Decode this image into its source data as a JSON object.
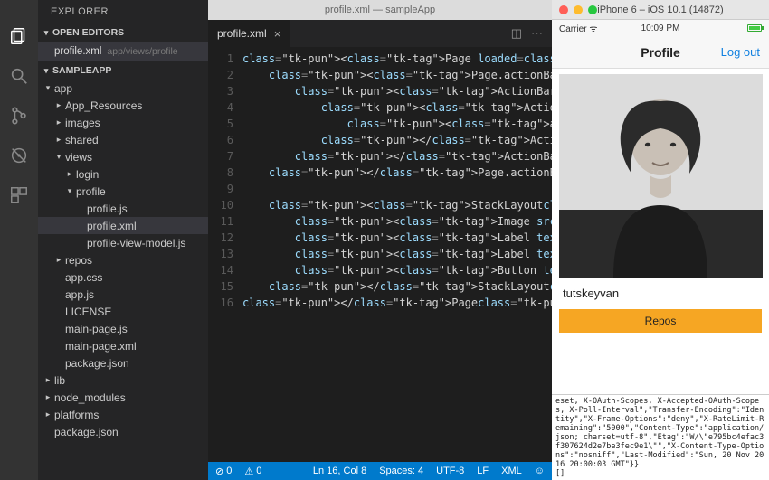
{
  "titlebar": "profile.xml — sampleApp",
  "explorer": {
    "title": "EXPLORER",
    "sections": {
      "open_editors": "OPEN EDITORS",
      "project": "SAMPLEAPP"
    },
    "open_editor": {
      "file": "profile.xml",
      "path": "app/views/profile"
    },
    "tree": [
      {
        "d": 0,
        "tw": "▾",
        "label": "app"
      },
      {
        "d": 1,
        "tw": "▸",
        "label": "App_Resources"
      },
      {
        "d": 1,
        "tw": "▸",
        "label": "images"
      },
      {
        "d": 1,
        "tw": "▸",
        "label": "shared"
      },
      {
        "d": 1,
        "tw": "▾",
        "label": "views"
      },
      {
        "d": 2,
        "tw": "▸",
        "label": "login"
      },
      {
        "d": 2,
        "tw": "▾",
        "label": "profile"
      },
      {
        "d": 3,
        "tw": "",
        "label": "profile.js"
      },
      {
        "d": 3,
        "tw": "",
        "label": "profile.xml",
        "sel": true
      },
      {
        "d": 3,
        "tw": "",
        "label": "profile-view-model.js"
      },
      {
        "d": 1,
        "tw": "▸",
        "label": "repos"
      },
      {
        "d": 1,
        "tw": "",
        "label": "app.css"
      },
      {
        "d": 1,
        "tw": "",
        "label": "app.js"
      },
      {
        "d": 1,
        "tw": "",
        "label": "LICENSE"
      },
      {
        "d": 1,
        "tw": "",
        "label": "main-page.js"
      },
      {
        "d": 1,
        "tw": "",
        "label": "main-page.xml"
      },
      {
        "d": 1,
        "tw": "",
        "label": "package.json"
      },
      {
        "d": 0,
        "tw": "▸",
        "label": "lib"
      },
      {
        "d": 0,
        "tw": "▸",
        "label": "node_modules"
      },
      {
        "d": 0,
        "tw": "▸",
        "label": "platforms"
      },
      {
        "d": 0,
        "tw": "",
        "label": "package.json"
      }
    ]
  },
  "editor": {
    "tab": {
      "label": "profile.xml"
    },
    "lines": [
      "<Page loaded=\"loaded\">",
      "    <Page.actionBar>",
      "        <ActionBar title=\"Profile\">",
      "            <ActionBar.actionItems>",
      "                <actionItem text=\"Log out\" ios.position",
      "            </ActionBar.actionItems>",
      "        </ActionBar>",
      "    </Page.actionBar>",
      "",
      "    <StackLayout>",
      "        <Image src=\"{{ avatar }}\" id=\"profile-avatar\"/>",
      "        <Label text=\"{{ fullName }}\" id=\"profile-fullna",
      "        <Label text=\"{{ login }}\"  id=\"profile-login\">",
      "        <Button text=\"Repos\" tap=\"onRepos\"/>",
      "    </StackLayout>",
      "</Page>"
    ]
  },
  "statusbar": {
    "errors": "0",
    "warnings": "0",
    "ln_col": "Ln 16, Col 8",
    "spaces": "Spaces: 4",
    "enc": "UTF-8",
    "eol": "LF",
    "lang": "XML",
    "smile": "☺"
  },
  "sim": {
    "window_title": "iPhone 6 – iOS 10.1 (14872)",
    "carrier": "Carrier",
    "wifi": "",
    "time": "10:09 PM",
    "nav_title": "Profile",
    "nav_right": "Log out",
    "username": "tutskeyvan",
    "button": "Repos",
    "console": "eset, X-OAuth-Scopes, X-Accepted-OAuth-Scopes, X-Poll-Interval\",\"Transfer-Encoding\":\"Identity\",\"X-Frame-Options\":\"deny\",\"X-RateLimit-Remaining\":\"5000\",\"Content-Type\":\"application/json; charset=utf-8\",\"Etag\":\"W/\\\"e795bc4efac3f307624d2e7be3fec9e1\\\"\",\"X-Content-Type-Options\":\"nosniff\",\"Last-Modified\":\"Sun, 20 Nov 2016 20:00:03 GMT\"}}\n[]"
  }
}
